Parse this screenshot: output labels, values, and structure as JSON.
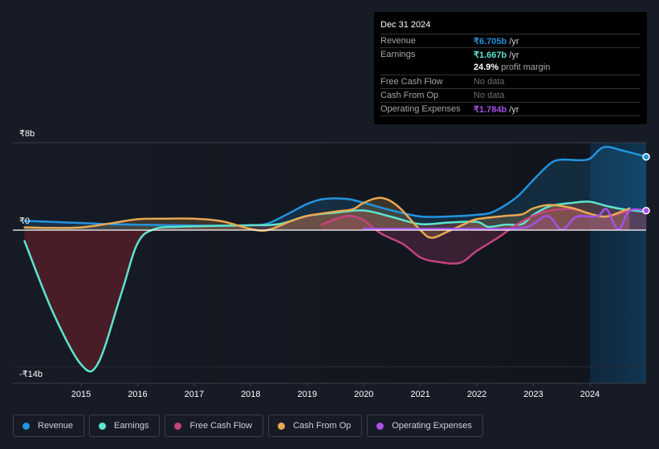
{
  "tooltip": {
    "date": "Dec 31 2024",
    "rows": [
      {
        "label": "Revenue",
        "value": "₹6.705b",
        "unit": " /yr",
        "color": "#2394df"
      },
      {
        "label": "Earnings",
        "value": "₹1.667b",
        "unit": " /yr",
        "color": "#5ee3cf"
      },
      {
        "label": "",
        "value": "24.9%",
        "unit": " profit margin",
        "color": "#ffffff"
      },
      {
        "label": "Free Cash Flow",
        "value": "No data",
        "unit": "",
        "color": "#6b6f77"
      },
      {
        "label": "Cash From Op",
        "value": "No data",
        "unit": "",
        "color": "#6b6f77"
      },
      {
        "label": "Operating Expenses",
        "value": "₹1.784b",
        "unit": " /yr",
        "color": "#a651eb"
      }
    ]
  },
  "legend": [
    {
      "label": "Revenue",
      "color": "#2394df"
    },
    {
      "label": "Earnings",
      "color": "#5ee3cf"
    },
    {
      "label": "Free Cash Flow",
      "color": "#c5437f"
    },
    {
      "label": "Cash From Op",
      "color": "#e8a852"
    },
    {
      "label": "Operating Expenses",
      "color": "#a651eb"
    }
  ],
  "chart_data": {
    "type": "line",
    "title": "",
    "xlabel": "",
    "ylabel": "",
    "ylim": [
      -14,
      8
    ],
    "xlim": [
      2014.0,
      2025.0
    ],
    "y_ticks": [
      {
        "value": 8,
        "label": "₹8b"
      },
      {
        "value": 0,
        "label": "₹0"
      },
      {
        "value": -14,
        "label": "-₹14b"
      }
    ],
    "x_ticks": [
      2015,
      2016,
      2017,
      2018,
      2019,
      2020,
      2021,
      2022,
      2023,
      2024
    ],
    "highlight_region_start": 2024.0,
    "grid": true,
    "legend_position": "bottom",
    "series": [
      {
        "name": "Revenue",
        "color": "#2394df",
        "points": [
          [
            2014.0,
            0.85
          ],
          [
            2014.5,
            0.75
          ],
          [
            2015.0,
            0.65
          ],
          [
            2015.5,
            0.55
          ],
          [
            2016.0,
            0.5
          ],
          [
            2016.5,
            0.45
          ],
          [
            2017.0,
            0.42
          ],
          [
            2017.5,
            0.4
          ],
          [
            2018.0,
            0.45
          ],
          [
            2018.3,
            0.6
          ],
          [
            2018.7,
            1.6
          ],
          [
            2019.0,
            2.4
          ],
          [
            2019.3,
            2.85
          ],
          [
            2019.7,
            2.85
          ],
          [
            2020.0,
            2.5
          ],
          [
            2020.5,
            1.8
          ],
          [
            2021.0,
            1.25
          ],
          [
            2021.5,
            1.25
          ],
          [
            2022.0,
            1.4
          ],
          [
            2022.3,
            1.7
          ],
          [
            2022.7,
            3.0
          ],
          [
            2023.0,
            4.6
          ],
          [
            2023.3,
            6.1
          ],
          [
            2023.5,
            6.45
          ],
          [
            2023.8,
            6.4
          ],
          [
            2024.0,
            6.55
          ],
          [
            2024.25,
            7.6
          ],
          [
            2024.6,
            7.25
          ],
          [
            2025.0,
            6.705
          ]
        ]
      },
      {
        "name": "Earnings",
        "color": "#5ee3cf",
        "points": [
          [
            2014.0,
            -1.0
          ],
          [
            2014.5,
            -7.5
          ],
          [
            2015.0,
            -12.3
          ],
          [
            2015.3,
            -12.2
          ],
          [
            2015.7,
            -6.0
          ],
          [
            2016.0,
            -1.2
          ],
          [
            2016.3,
            0.1
          ],
          [
            2016.7,
            0.3
          ],
          [
            2017.0,
            0.35
          ],
          [
            2017.5,
            0.4
          ],
          [
            2018.0,
            0.45
          ],
          [
            2018.5,
            0.55
          ],
          [
            2019.0,
            1.3
          ],
          [
            2019.5,
            1.6
          ],
          [
            2020.0,
            1.8
          ],
          [
            2020.5,
            1.2
          ],
          [
            2021.0,
            0.55
          ],
          [
            2021.5,
            0.7
          ],
          [
            2022.0,
            0.75
          ],
          [
            2022.2,
            0.3
          ],
          [
            2022.5,
            0.5
          ],
          [
            2022.8,
            0.55
          ],
          [
            2023.0,
            1.4
          ],
          [
            2023.3,
            2.2
          ],
          [
            2023.7,
            2.5
          ],
          [
            2024.0,
            2.6
          ],
          [
            2024.3,
            2.2
          ],
          [
            2024.6,
            1.9
          ],
          [
            2025.0,
            1.667
          ]
        ]
      },
      {
        "name": "Free Cash Flow",
        "color": "#c5437f",
        "points": [
          [
            2019.25,
            0.5
          ],
          [
            2019.5,
            1.0
          ],
          [
            2019.75,
            1.3
          ],
          [
            2020.0,
            0.9
          ],
          [
            2020.3,
            -0.3
          ],
          [
            2020.7,
            -1.3
          ],
          [
            2021.0,
            -2.5
          ],
          [
            2021.3,
            -2.9
          ],
          [
            2021.7,
            -3.0
          ],
          [
            2022.0,
            -1.9
          ],
          [
            2022.4,
            -0.6
          ],
          [
            2022.7,
            0.5
          ],
          [
            2023.0,
            1.3
          ],
          [
            2023.3,
            1.8
          ],
          [
            2023.7,
            1.9
          ],
          [
            2024.0,
            1.5
          ],
          [
            2024.3,
            1.25
          ],
          [
            2024.7,
            1.75
          ]
        ]
      },
      {
        "name": "Cash From Op",
        "color": "#e8a852",
        "points": [
          [
            2014.0,
            0.25
          ],
          [
            2014.5,
            0.2
          ],
          [
            2015.0,
            0.25
          ],
          [
            2015.5,
            0.6
          ],
          [
            2016.0,
            1.0
          ],
          [
            2016.5,
            1.05
          ],
          [
            2017.0,
            1.05
          ],
          [
            2017.5,
            0.8
          ],
          [
            2018.0,
            0.1
          ],
          [
            2018.3,
            0.0
          ],
          [
            2018.7,
            0.8
          ],
          [
            2019.0,
            1.3
          ],
          [
            2019.5,
            1.7
          ],
          [
            2019.8,
            1.9
          ],
          [
            2020.0,
            2.5
          ],
          [
            2020.3,
            2.95
          ],
          [
            2020.6,
            2.2
          ],
          [
            2021.0,
            0.0
          ],
          [
            2021.2,
            -0.7
          ],
          [
            2021.5,
            -0.1
          ],
          [
            2021.8,
            0.6
          ],
          [
            2022.0,
            1.0
          ],
          [
            2022.5,
            1.3
          ],
          [
            2022.8,
            1.45
          ],
          [
            2023.0,
            2.0
          ],
          [
            2023.3,
            2.3
          ],
          [
            2023.7,
            2.0
          ],
          [
            2024.0,
            1.5
          ],
          [
            2024.3,
            1.25
          ],
          [
            2024.7,
            2.0
          ]
        ]
      },
      {
        "name": "Operating Expenses",
        "color": "#a651eb",
        "points": [
          [
            2020.0,
            0.12
          ],
          [
            2020.5,
            0.12
          ],
          [
            2021.0,
            0.12
          ],
          [
            2021.5,
            0.12
          ],
          [
            2022.0,
            0.12
          ],
          [
            2022.5,
            0.12
          ],
          [
            2022.9,
            0.3
          ],
          [
            2023.25,
            1.3
          ],
          [
            2023.5,
            0.05
          ],
          [
            2023.75,
            1.2
          ],
          [
            2024.0,
            1.25
          ],
          [
            2024.15,
            1.3
          ],
          [
            2024.3,
            1.9
          ],
          [
            2024.5,
            0.05
          ],
          [
            2024.7,
            1.784
          ],
          [
            2025.0,
            1.784
          ]
        ]
      }
    ]
  }
}
